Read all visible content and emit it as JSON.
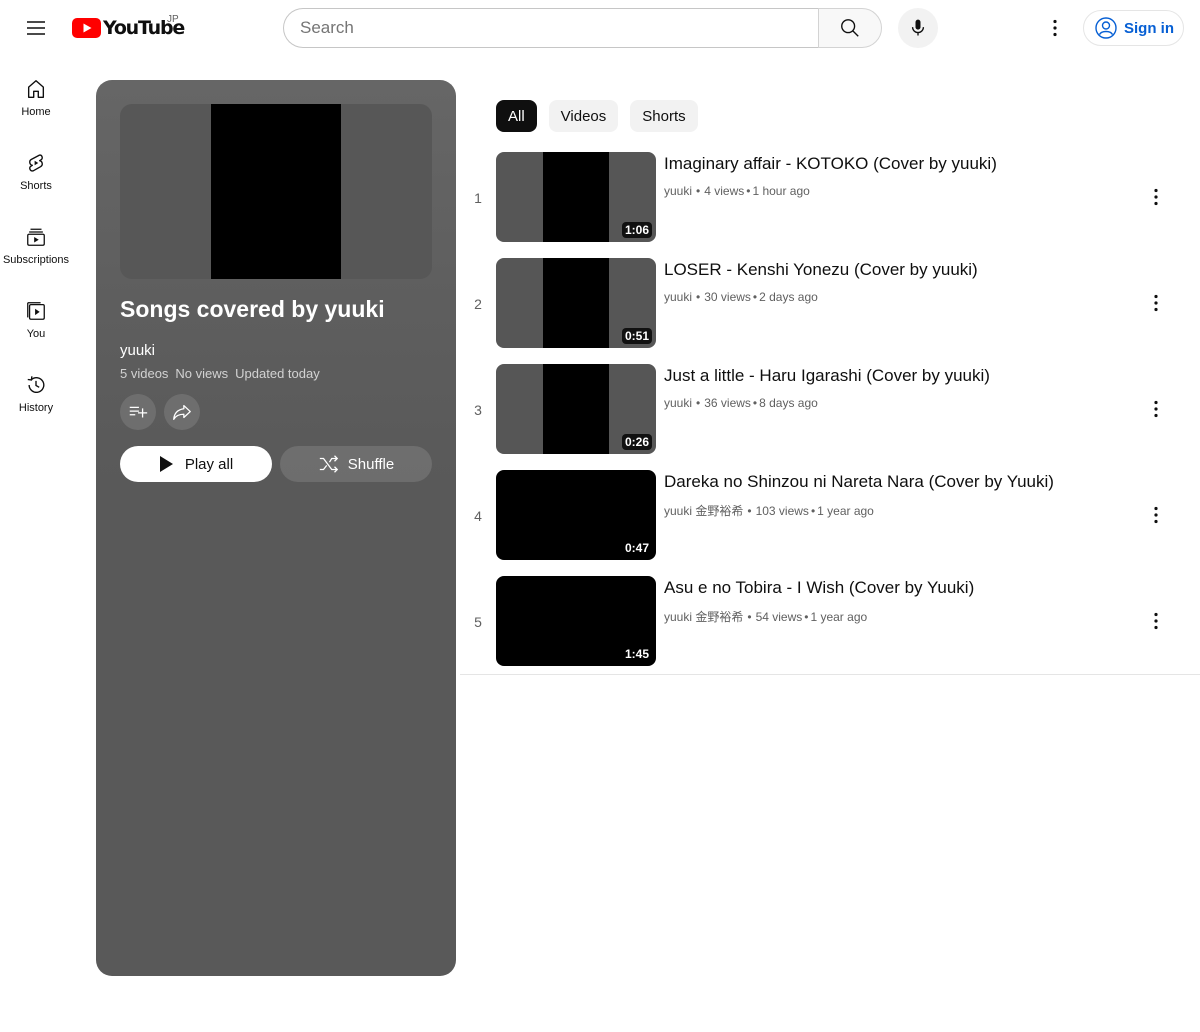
{
  "header": {
    "logo_text": "YouTube",
    "country_code": "JP",
    "search_placeholder": "Search",
    "signin_label": "Sign in"
  },
  "sidebar": {
    "items": [
      {
        "label": "Home",
        "icon": "home-icon"
      },
      {
        "label": "Shorts",
        "icon": "shorts-icon"
      },
      {
        "label": "Subscriptions",
        "icon": "subscriptions-icon"
      },
      {
        "label": "You",
        "icon": "you-icon"
      },
      {
        "label": "History",
        "icon": "history-icon"
      }
    ]
  },
  "playlist": {
    "title": "Songs covered by yuuki",
    "owner": "yuuki",
    "video_count": "5 videos",
    "views": "No views",
    "updated": "Updated today",
    "play_all_label": "Play all",
    "shuffle_label": "Shuffle"
  },
  "chips": [
    {
      "label": "All",
      "active": true
    },
    {
      "label": "Videos",
      "active": false
    },
    {
      "label": "Shorts",
      "active": false
    }
  ],
  "videos": [
    {
      "index": "1",
      "title": "Imaginary affair - KOTOKO (Cover by yuuki)",
      "channel": "yuuki",
      "views": "4 views",
      "age": "1 hour ago",
      "duration": "1:06"
    },
    {
      "index": "2",
      "title": "LOSER - Kenshi Yonezu (Cover by yuuki)",
      "channel": "yuuki",
      "views": "30 views",
      "age": "2 days ago",
      "duration": "0:51"
    },
    {
      "index": "3",
      "title": "Just a little - Haru Igarashi (Cover by yuuki)",
      "channel": "yuuki",
      "views": "36 views",
      "age": "8 days ago",
      "duration": "0:26"
    },
    {
      "index": "4",
      "title": "Dareka no Shinzou ni Nareta Nara (Cover by Yuuki)",
      "channel": "yuuki 金野裕希",
      "views": "103 views",
      "age": "1 year ago",
      "duration": "0:47"
    },
    {
      "index": "5",
      "title": "Asu e no Tobira - I Wish (Cover by Yuuki)",
      "channel": "yuuki 金野裕希",
      "views": "54 views",
      "age": "1 year ago",
      "duration": "1:45"
    }
  ],
  "colors": {
    "brand_red": "#ff0000",
    "link_blue": "#065fd4",
    "panel_gray": "#595959"
  }
}
